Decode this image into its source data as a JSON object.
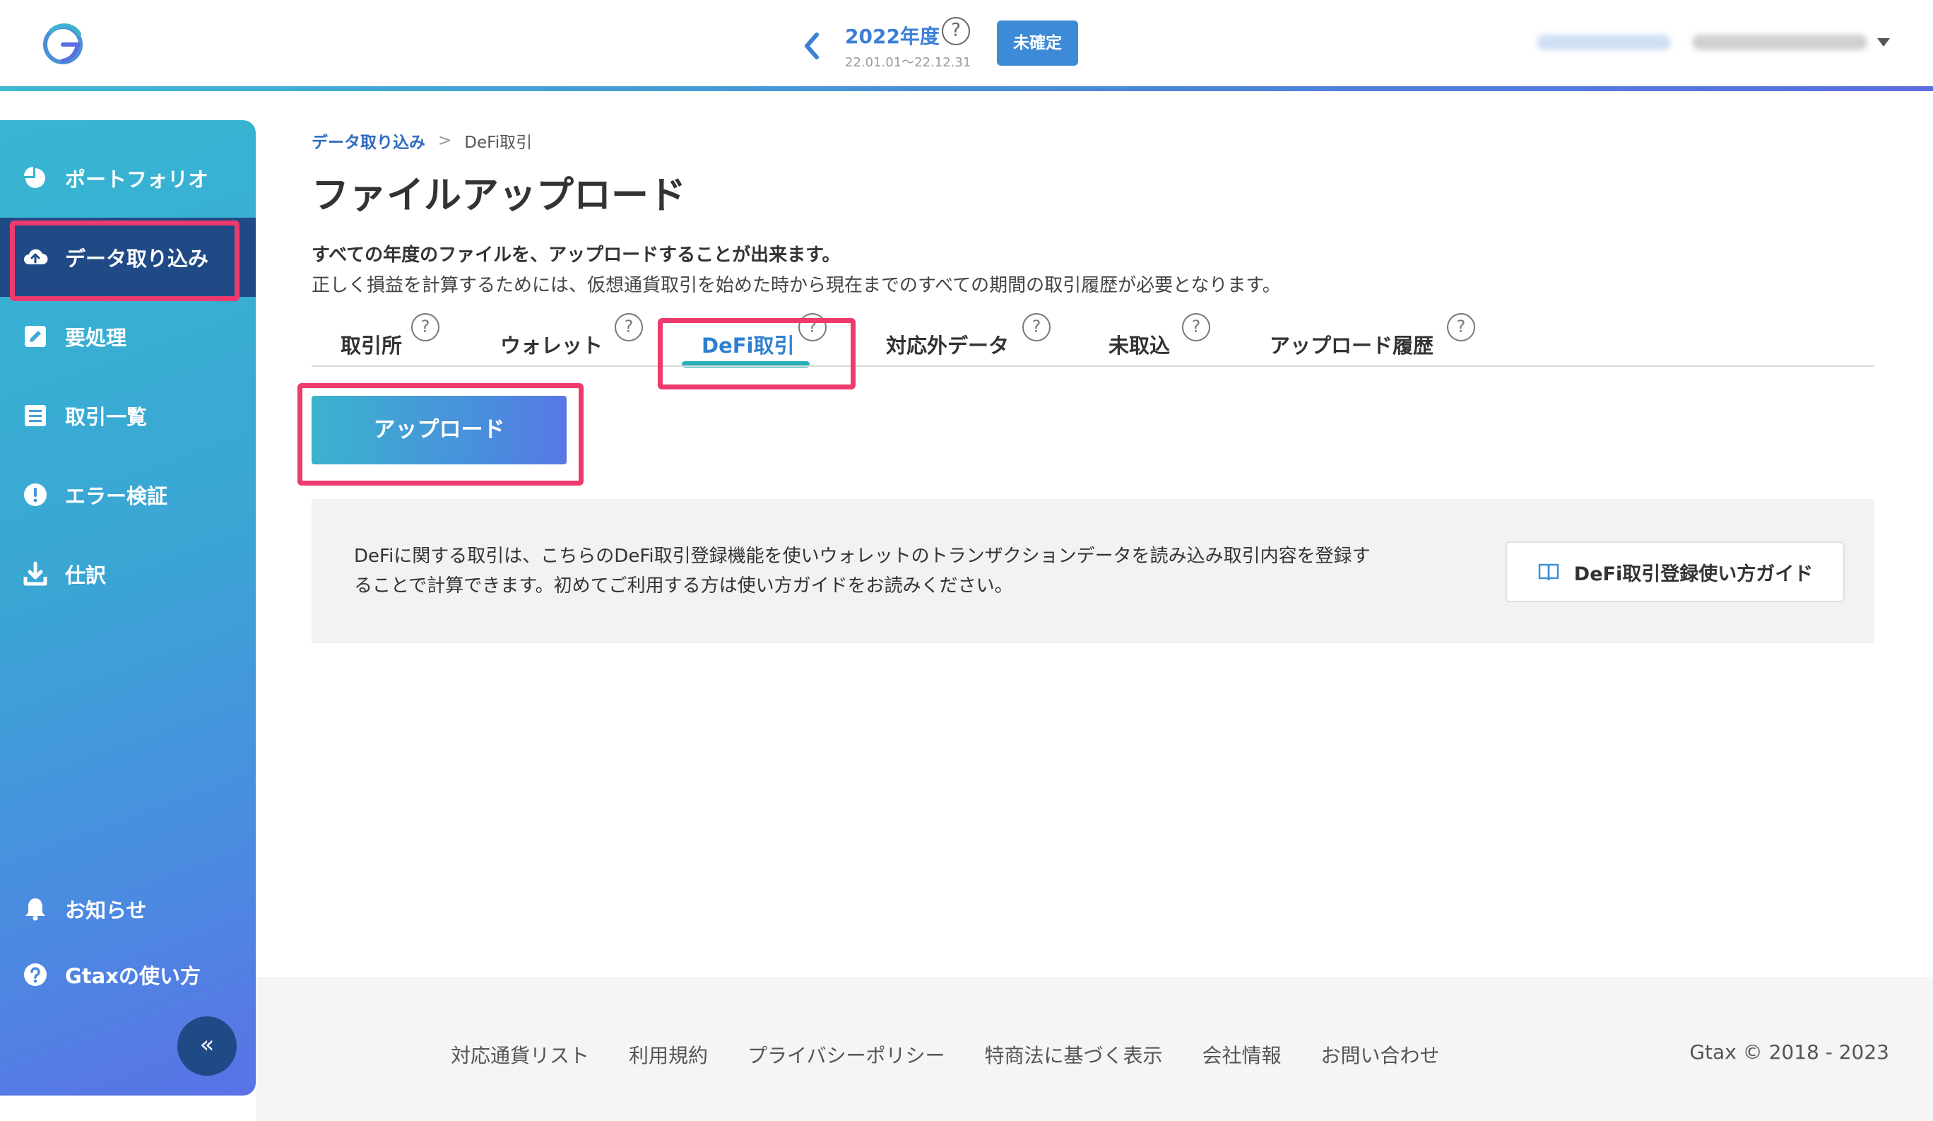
{
  "colors": {
    "accent": "#3d7fd6",
    "sidebar_active": "#1f4a86",
    "highlight": "#ee3a6c",
    "tab_underline": "#27aeb8"
  },
  "header": {
    "logo_icon": "gtax-logo",
    "fiscal_year": "2022年度",
    "period": "22.01.01〜22.12.31",
    "help_glyph": "?",
    "status": "未確定"
  },
  "sidebar": {
    "items": [
      {
        "label": "ポートフォリオ",
        "icon": "pie-chart-icon"
      },
      {
        "label": "データ取り込み",
        "icon": "cloud-upload-icon"
      },
      {
        "label": "要処理",
        "icon": "edit-icon"
      },
      {
        "label": "取引一覧",
        "icon": "list-icon"
      },
      {
        "label": "エラー検証",
        "icon": "alert-icon"
      },
      {
        "label": "仕訳",
        "icon": "download-icon"
      }
    ],
    "bottom_items": [
      {
        "label": "お知らせ",
        "icon": "bell-icon"
      },
      {
        "label": "Gtaxの使い方",
        "icon": "help-icon"
      }
    ],
    "collapse_glyph": "«"
  },
  "breadcrumb": {
    "parent": "データ取り込み",
    "separator": ">",
    "current": "DeFi取引"
  },
  "page": {
    "title": "ファイルアップロード",
    "description_bold": "すべての年度のファイルを、アップロードすることが出来ます。",
    "description": "正しく損益を計算するためには、仮想通貨取引を始めた時から現在までのすべての期間の取引履歴が必要となります。"
  },
  "tabs": [
    {
      "label": "取引所"
    },
    {
      "label": "ウォレット"
    },
    {
      "label": "DeFi取引"
    },
    {
      "label": "対応外データ"
    },
    {
      "label": "未取込"
    },
    {
      "label": "アップロード履歴"
    }
  ],
  "upload_button": "アップロード",
  "info": {
    "line1": "DeFiに関する取引は、こちらのDeFi取引登録機能を使いウォレットのトランザクションデータを読み込み取引内容を登録す",
    "line2": "ることで計算できます。初めてご利用する方は使い方ガイドをお読みください。",
    "guide_button": "DeFi取引登録使い方ガイド"
  },
  "footer": {
    "links": [
      "対応通貨リスト",
      "利用規約",
      "プライバシーポリシー",
      "特商法に基づく表示",
      "会社情報",
      "お問い合わせ"
    ],
    "copyright": "Gtax © 2018 - 2023"
  }
}
